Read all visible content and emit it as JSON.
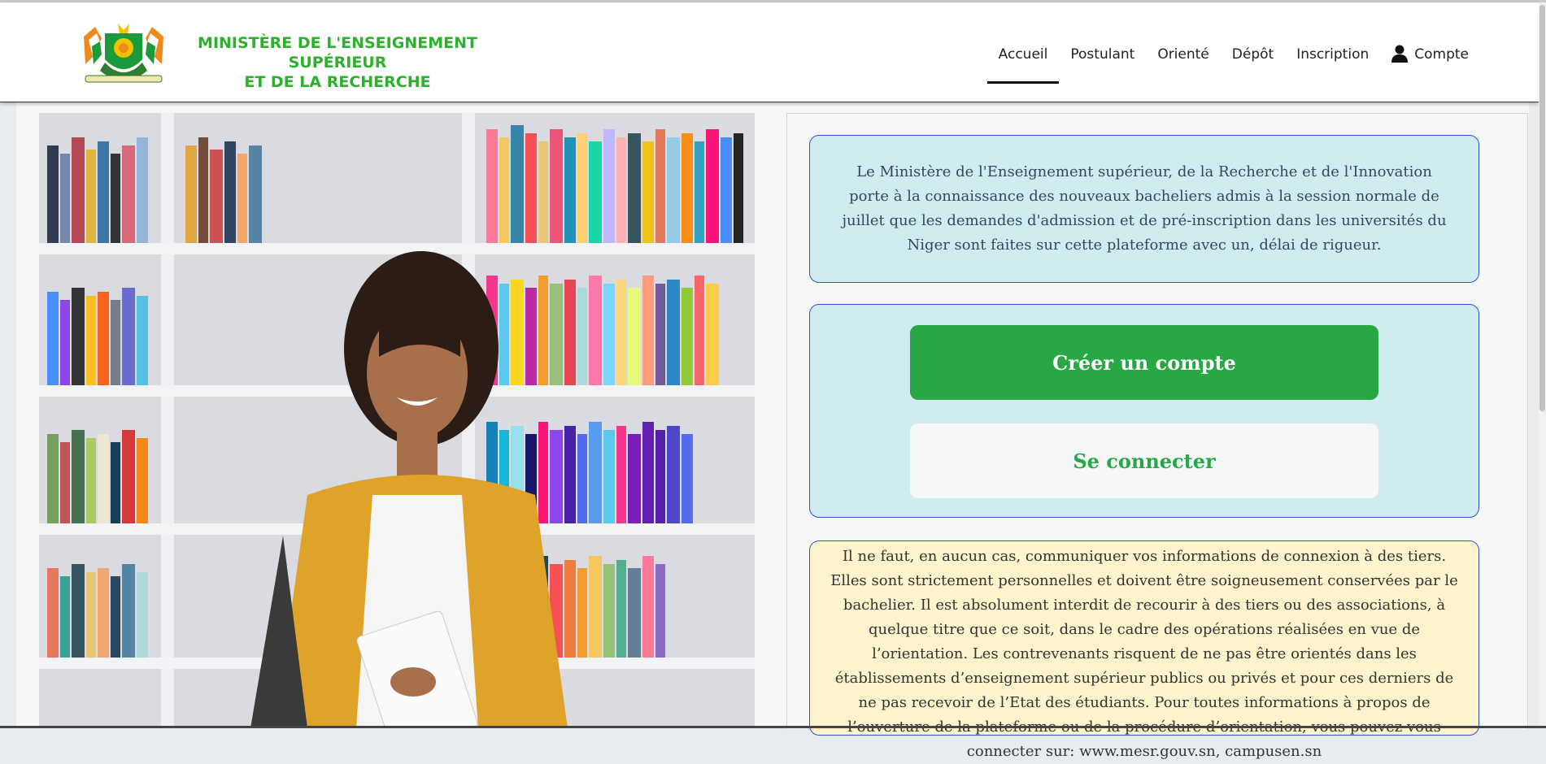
{
  "header": {
    "brand_line1": "MINISTÈRE DE L'ENSEIGNEMENT SUPÉRIEUR",
    "brand_line2": "ET DE LA RECHERCHE",
    "logo_icon": "coat-of-arms-icon",
    "nav": [
      {
        "label": "Accueil",
        "active": true
      },
      {
        "label": "Postulant"
      },
      {
        "label": "Orienté"
      },
      {
        "label": "Dépôt"
      },
      {
        "label": "Inscription"
      },
      {
        "label": "Compte",
        "icon": "user-icon"
      }
    ]
  },
  "hero": {
    "image": "student-with-bookshelf-photo"
  },
  "info": {
    "text": "Le Ministère de l'Enseignement supérieur, de la Recherche et de l'Innovation porte à la connaissance des nouveaux bacheliers admis à la session normale de juillet que les demandes d'admission et de pré-inscription dans les universités du Niger sont faites sur cette plateforme avec un, délai de rigueur."
  },
  "actions": {
    "create_label": "Créer un compte",
    "login_label": "Se connecter"
  },
  "warning": {
    "text": "Il ne faut, en aucun cas, communiquer vos informations de connexion à des tiers. Elles sont strictement personnelles et doivent être soigneusement conservées par le bachelier. Il est absolument interdit de recourir à des tiers ou des associations, à quelque titre que ce soit, dans le cadre des opérations réalisées en vue de l’orientation. Les contrevenants risquent de ne pas être orientés dans les établissements d’enseignement supérieur publics ou privés et pour ces derniers de ne pas recevoir de l’Etat des étudiants. Pour toutes informations à propos de l’ouverture de la plateforme ou de la procédure d’orientation, vous pouvez vous connecter sur: www.mesr.gouv.sn, campusen.sn"
  },
  "colors": {
    "brand_green": "#2bb12b",
    "button_green": "#28a745",
    "info_bg": "#d1ecf1",
    "warn_bg": "#fdf3cd",
    "box_border": "#2a55d6"
  }
}
